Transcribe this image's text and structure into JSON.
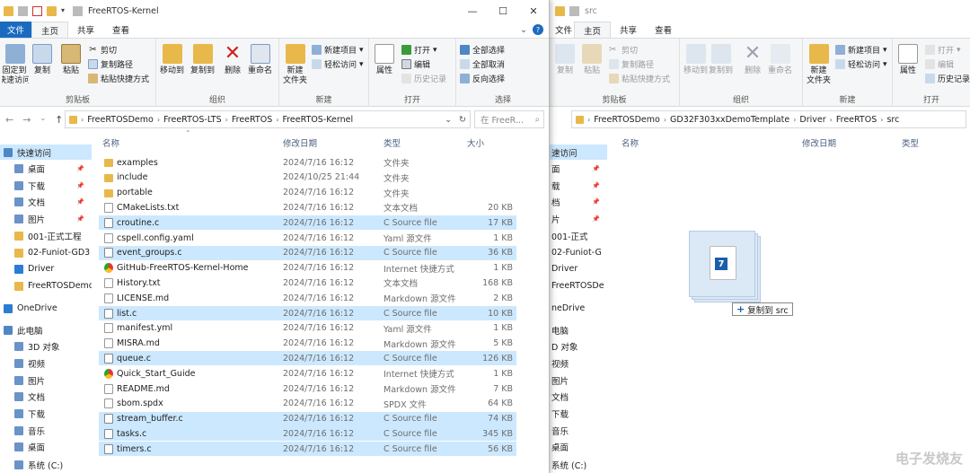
{
  "left": {
    "title": "FreeRTOS-Kernel",
    "tabs": [
      "文件",
      "主页",
      "共享",
      "查看"
    ],
    "ribbon": {
      "clipboard": {
        "pin": "固定到\n快速访问",
        "copy": "复制",
        "paste": "粘贴",
        "cut": "剪切",
        "copy_path": "复制路径",
        "paste_shortcut": "粘贴快捷方式",
        "label": "剪贴板"
      },
      "organize": {
        "move_to": "移动到",
        "copy_to": "复制到",
        "delete": "删除",
        "rename": "重命名",
        "label": "组织"
      },
      "new": {
        "new_folder": "新建\n文件夹",
        "new_item": "新建项目",
        "easy_access": "轻松访问",
        "label": "新建"
      },
      "open": {
        "properties": "属性",
        "open": "打开",
        "edit": "编辑",
        "history": "历史记录",
        "label": "打开"
      },
      "select": {
        "select_all": "全部选择",
        "select_none": "全部取消",
        "invert": "反向选择",
        "label": "选择"
      }
    },
    "breadcrumb": [
      "FreeRTOSDemo",
      "FreeRTOS-LTS",
      "FreeRTOS",
      "FreeRTOS-Kernel"
    ],
    "search_placeholder": "在 FreeR...",
    "sidebar": [
      {
        "label": "快速访问",
        "top": true,
        "sel": true
      },
      {
        "label": "桌面",
        "pin": true
      },
      {
        "label": "下载",
        "pin": true
      },
      {
        "label": "文档",
        "pin": true
      },
      {
        "label": "图片",
        "pin": true
      },
      {
        "label": "001-正式工程"
      },
      {
        "label": "02-Funiot-GD3"
      },
      {
        "label": "Driver"
      },
      {
        "label": "FreeRTOSDemo"
      },
      {
        "label": "OneDrive",
        "top": true
      },
      {
        "label": "此电脑",
        "top": true
      },
      {
        "label": "3D 对象"
      },
      {
        "label": "视频"
      },
      {
        "label": "图片"
      },
      {
        "label": "文档"
      },
      {
        "label": "下载"
      },
      {
        "label": "音乐"
      },
      {
        "label": "桌面"
      },
      {
        "label": "系统 (C:)"
      }
    ],
    "columns": {
      "name": "名称",
      "date": "修改日期",
      "type": "类型",
      "size": "大小"
    },
    "files": [
      {
        "name": "examples",
        "date": "2024/7/16 16:12",
        "type": "文件夹",
        "size": "",
        "kind": "folder",
        "sel": false
      },
      {
        "name": "include",
        "date": "2024/10/25 21:44",
        "type": "文件夹",
        "size": "",
        "kind": "folder",
        "sel": false
      },
      {
        "name": "portable",
        "date": "2024/7/16 16:12",
        "type": "文件夹",
        "size": "",
        "kind": "folder",
        "sel": false
      },
      {
        "name": "CMakeLists.txt",
        "date": "2024/7/16 16:12",
        "type": "文本文档",
        "size": "20 KB",
        "kind": "txt",
        "sel": false
      },
      {
        "name": "croutine.c",
        "date": "2024/7/16 16:12",
        "type": "C Source file",
        "size": "17 KB",
        "kind": "c",
        "sel": true
      },
      {
        "name": "cspell.config.yaml",
        "date": "2024/7/16 16:12",
        "type": "Yaml 源文件",
        "size": "1 KB",
        "kind": "txt",
        "sel": false
      },
      {
        "name": "event_groups.c",
        "date": "2024/7/16 16:12",
        "type": "C Source file",
        "size": "36 KB",
        "kind": "c",
        "sel": true
      },
      {
        "name": "GitHub-FreeRTOS-Kernel-Home",
        "date": "2024/7/16 16:12",
        "type": "Internet 快捷方式",
        "size": "1 KB",
        "kind": "web",
        "sel": false
      },
      {
        "name": "History.txt",
        "date": "2024/7/16 16:12",
        "type": "文本文档",
        "size": "168 KB",
        "kind": "txt",
        "sel": false
      },
      {
        "name": "LICENSE.md",
        "date": "2024/7/16 16:12",
        "type": "Markdown 源文件",
        "size": "2 KB",
        "kind": "txt",
        "sel": false
      },
      {
        "name": "list.c",
        "date": "2024/7/16 16:12",
        "type": "C Source file",
        "size": "10 KB",
        "kind": "c",
        "sel": true
      },
      {
        "name": "manifest.yml",
        "date": "2024/7/16 16:12",
        "type": "Yaml 源文件",
        "size": "1 KB",
        "kind": "txt",
        "sel": false
      },
      {
        "name": "MISRA.md",
        "date": "2024/7/16 16:12",
        "type": "Markdown 源文件",
        "size": "5 KB",
        "kind": "txt",
        "sel": false
      },
      {
        "name": "queue.c",
        "date": "2024/7/16 16:12",
        "type": "C Source file",
        "size": "126 KB",
        "kind": "c",
        "sel": true
      },
      {
        "name": "Quick_Start_Guide",
        "date": "2024/7/16 16:12",
        "type": "Internet 快捷方式",
        "size": "1 KB",
        "kind": "web",
        "sel": false
      },
      {
        "name": "README.md",
        "date": "2024/7/16 16:12",
        "type": "Markdown 源文件",
        "size": "7 KB",
        "kind": "txt",
        "sel": false
      },
      {
        "name": "sbom.spdx",
        "date": "2024/7/16 16:12",
        "type": "SPDX 文件",
        "size": "64 KB",
        "kind": "txt",
        "sel": false
      },
      {
        "name": "stream_buffer.c",
        "date": "2024/7/16 16:12",
        "type": "C Source file",
        "size": "74 KB",
        "kind": "c",
        "sel": true
      },
      {
        "name": "tasks.c",
        "date": "2024/7/16 16:12",
        "type": "C Source file",
        "size": "345 KB",
        "kind": "c",
        "sel": true
      },
      {
        "name": "timers.c",
        "date": "2024/7/16 16:12",
        "type": "C Source file",
        "size": "56 KB",
        "kind": "c",
        "sel": true
      }
    ]
  },
  "right": {
    "title": "src",
    "tabs": [
      "文件",
      "主页",
      "共享",
      "查看"
    ],
    "ribbon": {
      "copy": "复制",
      "paste": "粘贴",
      "cut": "剪切",
      "copy_path": "复制路径",
      "paste_shortcut": "粘贴快捷方式",
      "clip_label": "剪贴板",
      "move_to": "移动到",
      "copy_to": "复制到",
      "delete": "删除",
      "rename": "重命名",
      "org_label": "组织",
      "new_folder": "新建\n文件夹",
      "new_item": "新建项目",
      "easy_access": "轻松访问",
      "new_label": "新建",
      "properties": "属性",
      "open": "打开",
      "edit": "编辑",
      "history": "历史记录",
      "open_label": "打开"
    },
    "breadcrumb": [
      "FreeRTOSDemo",
      "GD32F303xxDemoTemplate",
      "Driver",
      "FreeRTOS",
      "src"
    ],
    "sidebar": [
      {
        "label": "速访问",
        "sel": true
      },
      {
        "label": "面",
        "pin": true
      },
      {
        "label": "载",
        "pin": true
      },
      {
        "label": "档",
        "pin": true
      },
      {
        "label": "片",
        "pin": true
      },
      {
        "label": "001-正式"
      },
      {
        "label": "02-Funiot-G"
      },
      {
        "label": "Driver"
      },
      {
        "label": "FreeRTOSDe"
      },
      {
        "label": "neDrive"
      },
      {
        "label": "电脑"
      },
      {
        "label": "D 对象"
      },
      {
        "label": "视频"
      },
      {
        "label": "图片"
      },
      {
        "label": "文档"
      },
      {
        "label": "下载"
      },
      {
        "label": "音乐"
      },
      {
        "label": "桌面"
      },
      {
        "label": "系统 (C:)"
      }
    ],
    "columns": {
      "name": "名称",
      "date": "修改日期",
      "type": "类型"
    }
  },
  "drag": {
    "badge": "7",
    "tooltip": "复制到 src"
  },
  "watermark": "电子发烧友"
}
